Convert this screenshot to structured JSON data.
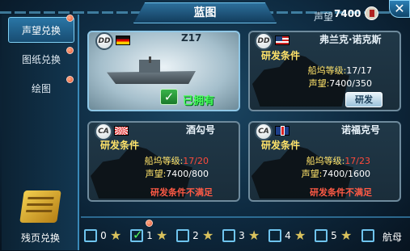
{
  "header": {
    "title": "蓝图",
    "prestige_label": "声望",
    "prestige_value": "7400"
  },
  "sidebar": {
    "items": [
      {
        "label": "声望兑换",
        "active": true
      },
      {
        "label": "图纸兑换",
        "active": false
      },
      {
        "label": "绘图",
        "active": false
      }
    ],
    "bottom_label": "残页兑换"
  },
  "cards": [
    {
      "name": "Z17",
      "class_tag": "DD",
      "flag": "germany",
      "owned": true,
      "owned_label": "已拥有"
    },
    {
      "name": "弗兰克·诺克斯",
      "class_tag": "DD",
      "flag": "usa",
      "requirement_title": "研发条件",
      "dock_label": "船坞等级:",
      "dock_value": "17/17",
      "prestige_label": "声望:",
      "prestige_value": "7400/350",
      "button_label": "研发"
    },
    {
      "name": "酒勾号",
      "class_tag": "CA",
      "flag": "japan",
      "requirement_title": "研发条件",
      "dock_label": "船坞等级:",
      "dock_value": "17/20",
      "prestige_label": "声望:",
      "prestige_value": "7400/800",
      "status": "研发条件不满足"
    },
    {
      "name": "诺福克号",
      "class_tag": "CA",
      "flag": "uk",
      "requirement_title": "研发条件",
      "dock_label": "船坞等级:",
      "dock_value": "17/23",
      "prestige_label": "声望:",
      "prestige_value": "7400/1600",
      "status": "研发条件不满足"
    }
  ],
  "filters": {
    "levels": [
      {
        "label": "0",
        "checked": false
      },
      {
        "label": "1",
        "checked": true
      },
      {
        "label": "2",
        "checked": false
      },
      {
        "label": "3",
        "checked": false
      },
      {
        "label": "4",
        "checked": false
      },
      {
        "label": "5",
        "checked": false
      }
    ],
    "carrier_label": "航母"
  },
  "colors": {
    "accent": "#6fc4ee",
    "requirement": "#ffe36a",
    "unmet": "#ff4a3a",
    "owned": "#48ff5a"
  }
}
